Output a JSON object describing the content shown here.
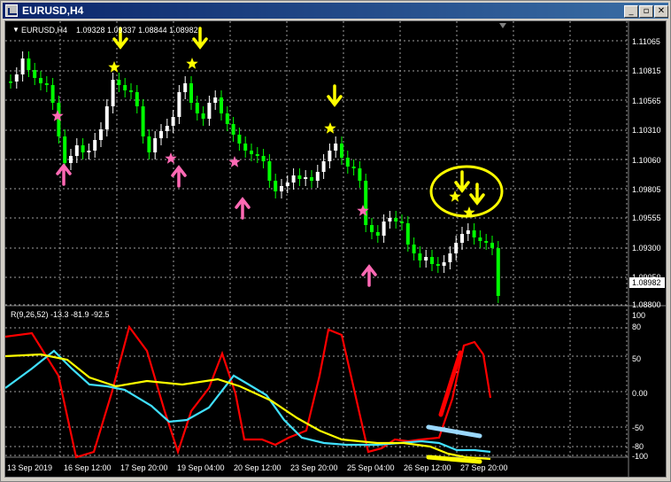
{
  "window": {
    "title": "EURUSD,H4",
    "minimize_glyph": "_",
    "restore_glyph": "▫",
    "close_glyph": "✕"
  },
  "price_panel": {
    "symbol_header": "EURUSD,H4",
    "ohlc_header": "1.09328 1.09337 1.08844 1.08982",
    "price_scale": [
      "1.11065",
      "1.10815",
      "1.10565",
      "1.10310",
      "1.10060",
      "1.09805",
      "1.09555",
      "1.09300",
      "1.09050",
      "1.08800"
    ],
    "current_price": "1.08982"
  },
  "indicator_panel": {
    "header": "R(9,26,52) -13.3 -81.9 -92.5",
    "scale": [
      "100",
      "80",
      "50",
      "0.00",
      "-50",
      "-80",
      "-100"
    ]
  },
  "time_axis": [
    "13 Sep 2019",
    "16 Sep 12:00",
    "17 Sep 20:00",
    "19 Sep 04:00",
    "20 Sep 12:00",
    "23 Sep 20:00",
    "25 Sep 04:00",
    "26 Sep 12:00",
    "27 Sep 20:00"
  ],
  "colors": {
    "background": "#000000",
    "grid": "#a0a0a0",
    "bull_candle": "#ffffff",
    "bear_candle": "#00ff00",
    "signal_star": "#ffff00",
    "signal_arrow_down": "#ffff00",
    "signal_arrow_up": "#ff69b4",
    "signal_star_buy": "#ff69b4",
    "line_red": "#ff0000",
    "line_cyan": "#40e0ff",
    "line_yellow": "#ffff00",
    "annotation_circle": "#ffff00"
  },
  "icons": {
    "app": "chart-window-icon",
    "down_signal": "arrow-down-icon",
    "up_signal": "arrow-up-icon",
    "star": "star-icon"
  }
}
